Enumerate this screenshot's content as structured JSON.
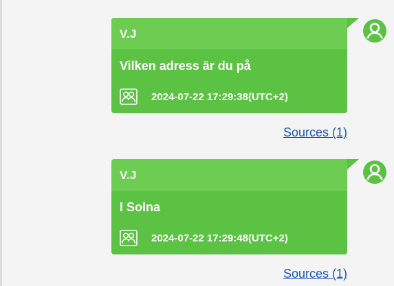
{
  "messages": [
    {
      "sender": "V.J",
      "text": "Vilken adress är du på",
      "timestamp": "2024-07-22 17:29:38(UTC+2)",
      "sources_label": "Sources (1)",
      "avatar_icon": "user-circle-icon",
      "meta_icon": "people-group-icon"
    },
    {
      "sender": "V.J",
      "text": "I Solna",
      "timestamp": "2024-07-22 17:29:48(UTC+2)",
      "sources_label": "Sources (1)",
      "avatar_icon": "user-circle-icon",
      "meta_icon": "people-group-icon"
    }
  ],
  "colors": {
    "bubble": "#5cc243",
    "bubble_header": "#6ccd52",
    "text": "#ffffff",
    "link": "#1a56b8",
    "background": "#f4f4f4"
  }
}
